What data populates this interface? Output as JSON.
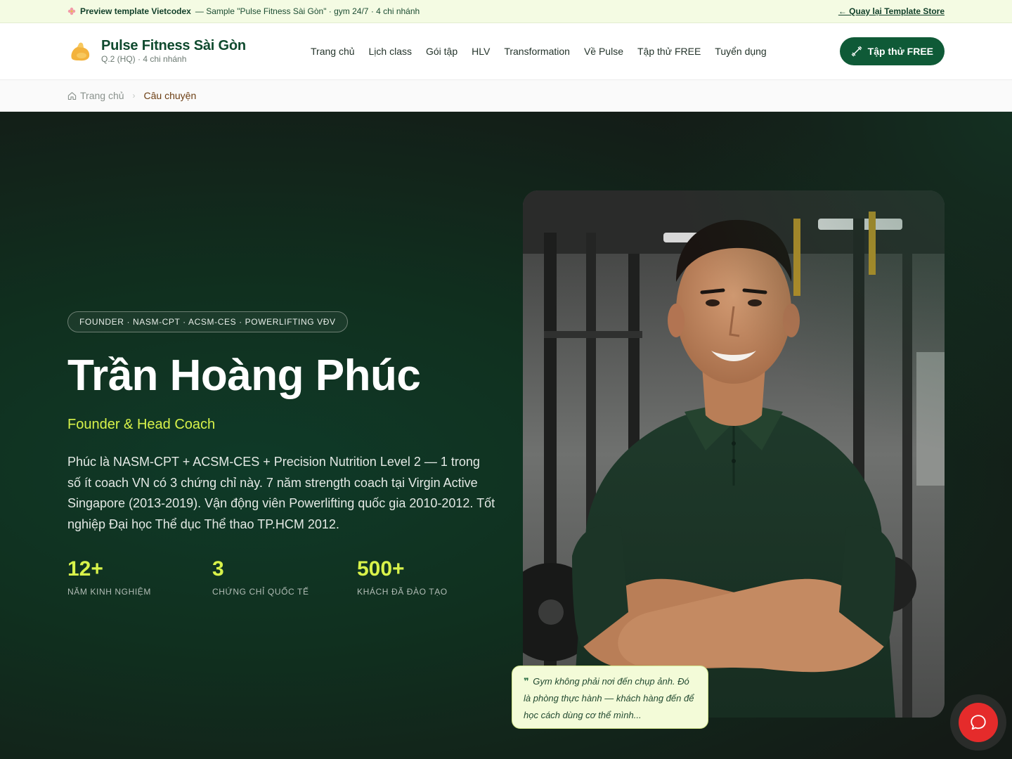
{
  "preview_bar": {
    "label": "Preview template Vietcodex",
    "description": "— Sample \"Pulse Fitness Sài Gòn\" · gym 24/7 · 4 chi nhánh",
    "back_link": "← Quay lại Template Store"
  },
  "header": {
    "brand_name": "Pulse Fitness Sài Gòn",
    "brand_sub": "Q.2 (HQ) · 4 chi nhánh",
    "nav": [
      "Trang chủ",
      "Lịch class",
      "Gói tập",
      "HLV",
      "Transformation",
      "Về Pulse",
      "Tập thử FREE",
      "Tuyển dụng"
    ],
    "cta_label": "Tập thử FREE"
  },
  "breadcrumb": {
    "home": "Trang chủ",
    "current": "Câu chuyện"
  },
  "hero": {
    "badge": "FOUNDER · NASM-CPT · ACSM-CES · POWERLIFTING VĐV",
    "name": "Trần Hoàng Phúc",
    "role": "Founder & Head Coach",
    "bio": "Phúc là NASM-CPT + ACSM-CES + Precision Nutrition Level 2 — 1 trong số ít coach VN có 3 chứng chỉ này. 7 năm strength coach tại Virgin Active Singapore (2013-2019). Vận động viên Powerlifting quốc gia 2010-2012. Tốt nghiệp Đại học Thể dục Thể thao TP.HCM 2012.",
    "stats": [
      {
        "value": "12+",
        "label": "NĂM KINH NGHIỆM"
      },
      {
        "value": "3",
        "label": "CHỨNG CHỈ QUỐC TẾ"
      },
      {
        "value": "500+",
        "label": "KHÁCH ĐÃ ĐÀO TẠO"
      }
    ],
    "quote": "Gym không phải nơi đến chụp ảnh. Đó là phòng thực hành — khách hàng đến để học cách dùng cơ thể mình..."
  },
  "colors": {
    "brand_green": "#0f5a37",
    "accent_lime": "#d8f24a",
    "hero_bg": "#10301f",
    "chat_red": "#e52b2b"
  },
  "icons": [
    "flower-icon",
    "flexed-arm-logo",
    "dumbbell-icon",
    "home-icon",
    "chevron-right-icon",
    "quote-icon",
    "chat-bubble-icon"
  ]
}
